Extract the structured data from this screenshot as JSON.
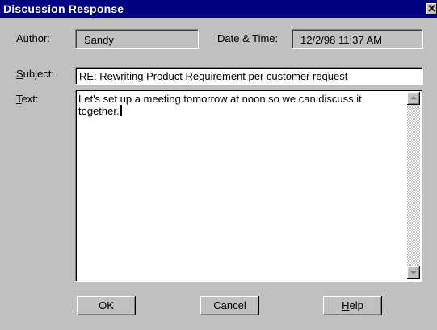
{
  "window": {
    "title": "Discussion Response",
    "close_glyph": "✕"
  },
  "form": {
    "author_label": "Author:",
    "author_value": "Sandy",
    "datetime_label": "Date & Time:",
    "datetime_value": "12/2/98 11:37 AM",
    "subject_label_access": "S",
    "subject_label_rest": "ubject:",
    "subject_value": "RE: Rewriting Product Requirement per customer request",
    "text_label_access": "T",
    "text_label_rest": "ext:",
    "text_value": "Let's set up a meeting tomorrow at noon so we can discuss it together."
  },
  "buttons": {
    "ok_label": "OK",
    "cancel_label": "Cancel",
    "help_label_access": "H",
    "help_label_rest": "elp"
  },
  "colors": {
    "titlebar": "#000080",
    "face": "#c0c0c0"
  },
  "icons": {
    "close": "close-icon",
    "scroll_up": "scroll-up-arrow-icon",
    "scroll_down": "scroll-down-arrow-icon"
  }
}
